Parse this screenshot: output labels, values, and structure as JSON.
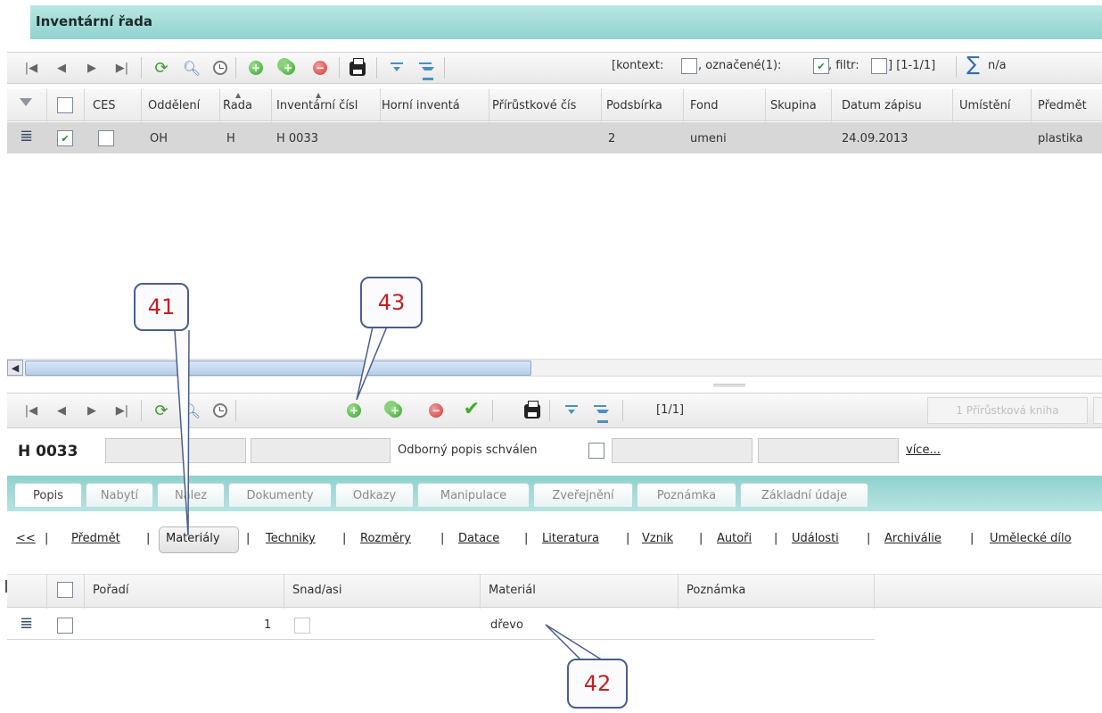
{
  "window_title": "Inventární řada",
  "top_toolbar": {
    "context_label": "[kontext:",
    "marked_label": ", označené(1):",
    "filter_label": ", filtr:",
    "range_label": "] [1-1/1]",
    "sum_value": "n/a"
  },
  "main_grid": {
    "columns": [
      "CES",
      "Oddělení",
      "Řada",
      "Inventární čísl",
      "Horní inventá",
      "Přírůstkové čís",
      "Podsbírka",
      "Fond",
      "Skupina",
      "Datum zápisu",
      "Umístění",
      "Předmět"
    ],
    "row": {
      "ces_checked": false,
      "selected": true,
      "oddeleni": "OH",
      "rada": "H",
      "inventarni_cislo": "H 0033",
      "horni_inventarni": "",
      "prirustkove_cislo": "",
      "podsbirka": "2",
      "fond": "umeni",
      "skupina": "",
      "datum_zapisu": "24.09.2013",
      "umisteni": "",
      "predmet": "plastika"
    }
  },
  "detail_toolbar": {
    "range_label": "[1/1]",
    "book_button": "1 Přírůstková kniha"
  },
  "record_header": {
    "record_id": "H 0033",
    "approved_label": "Odborný popis schválen",
    "more_link": "více..."
  },
  "tabs": [
    "Popis",
    "Nabytí",
    "Nález",
    "Dokumenty",
    "Odkazy",
    "Manipulace",
    "Zveřejnění",
    "Poznámka",
    "Základní údaje"
  ],
  "subnav": {
    "back": "<<",
    "items": [
      "Předmět",
      "Materiály",
      "Techniky",
      "Rozměry",
      "Datace",
      "Literatura",
      "Vznik",
      "Autoři",
      "Události",
      "Archiválie",
      "Umělecké dílo"
    ],
    "active": "Materiály"
  },
  "materials_grid": {
    "columns": [
      "Pořadí",
      "Snad/asi",
      "Materiál",
      "Poznámka"
    ],
    "rows": [
      {
        "poradi": "1",
        "snad_asi": false,
        "material": "dřevo",
        "poznamka": ""
      }
    ]
  },
  "callouts": [
    "41",
    "43",
    "42"
  ],
  "colors": {
    "title_bar": "#a6dcd9",
    "callout_text": "#c42020",
    "callout_border": "#4a5e8c",
    "selected_row": "#d7d7d7"
  }
}
